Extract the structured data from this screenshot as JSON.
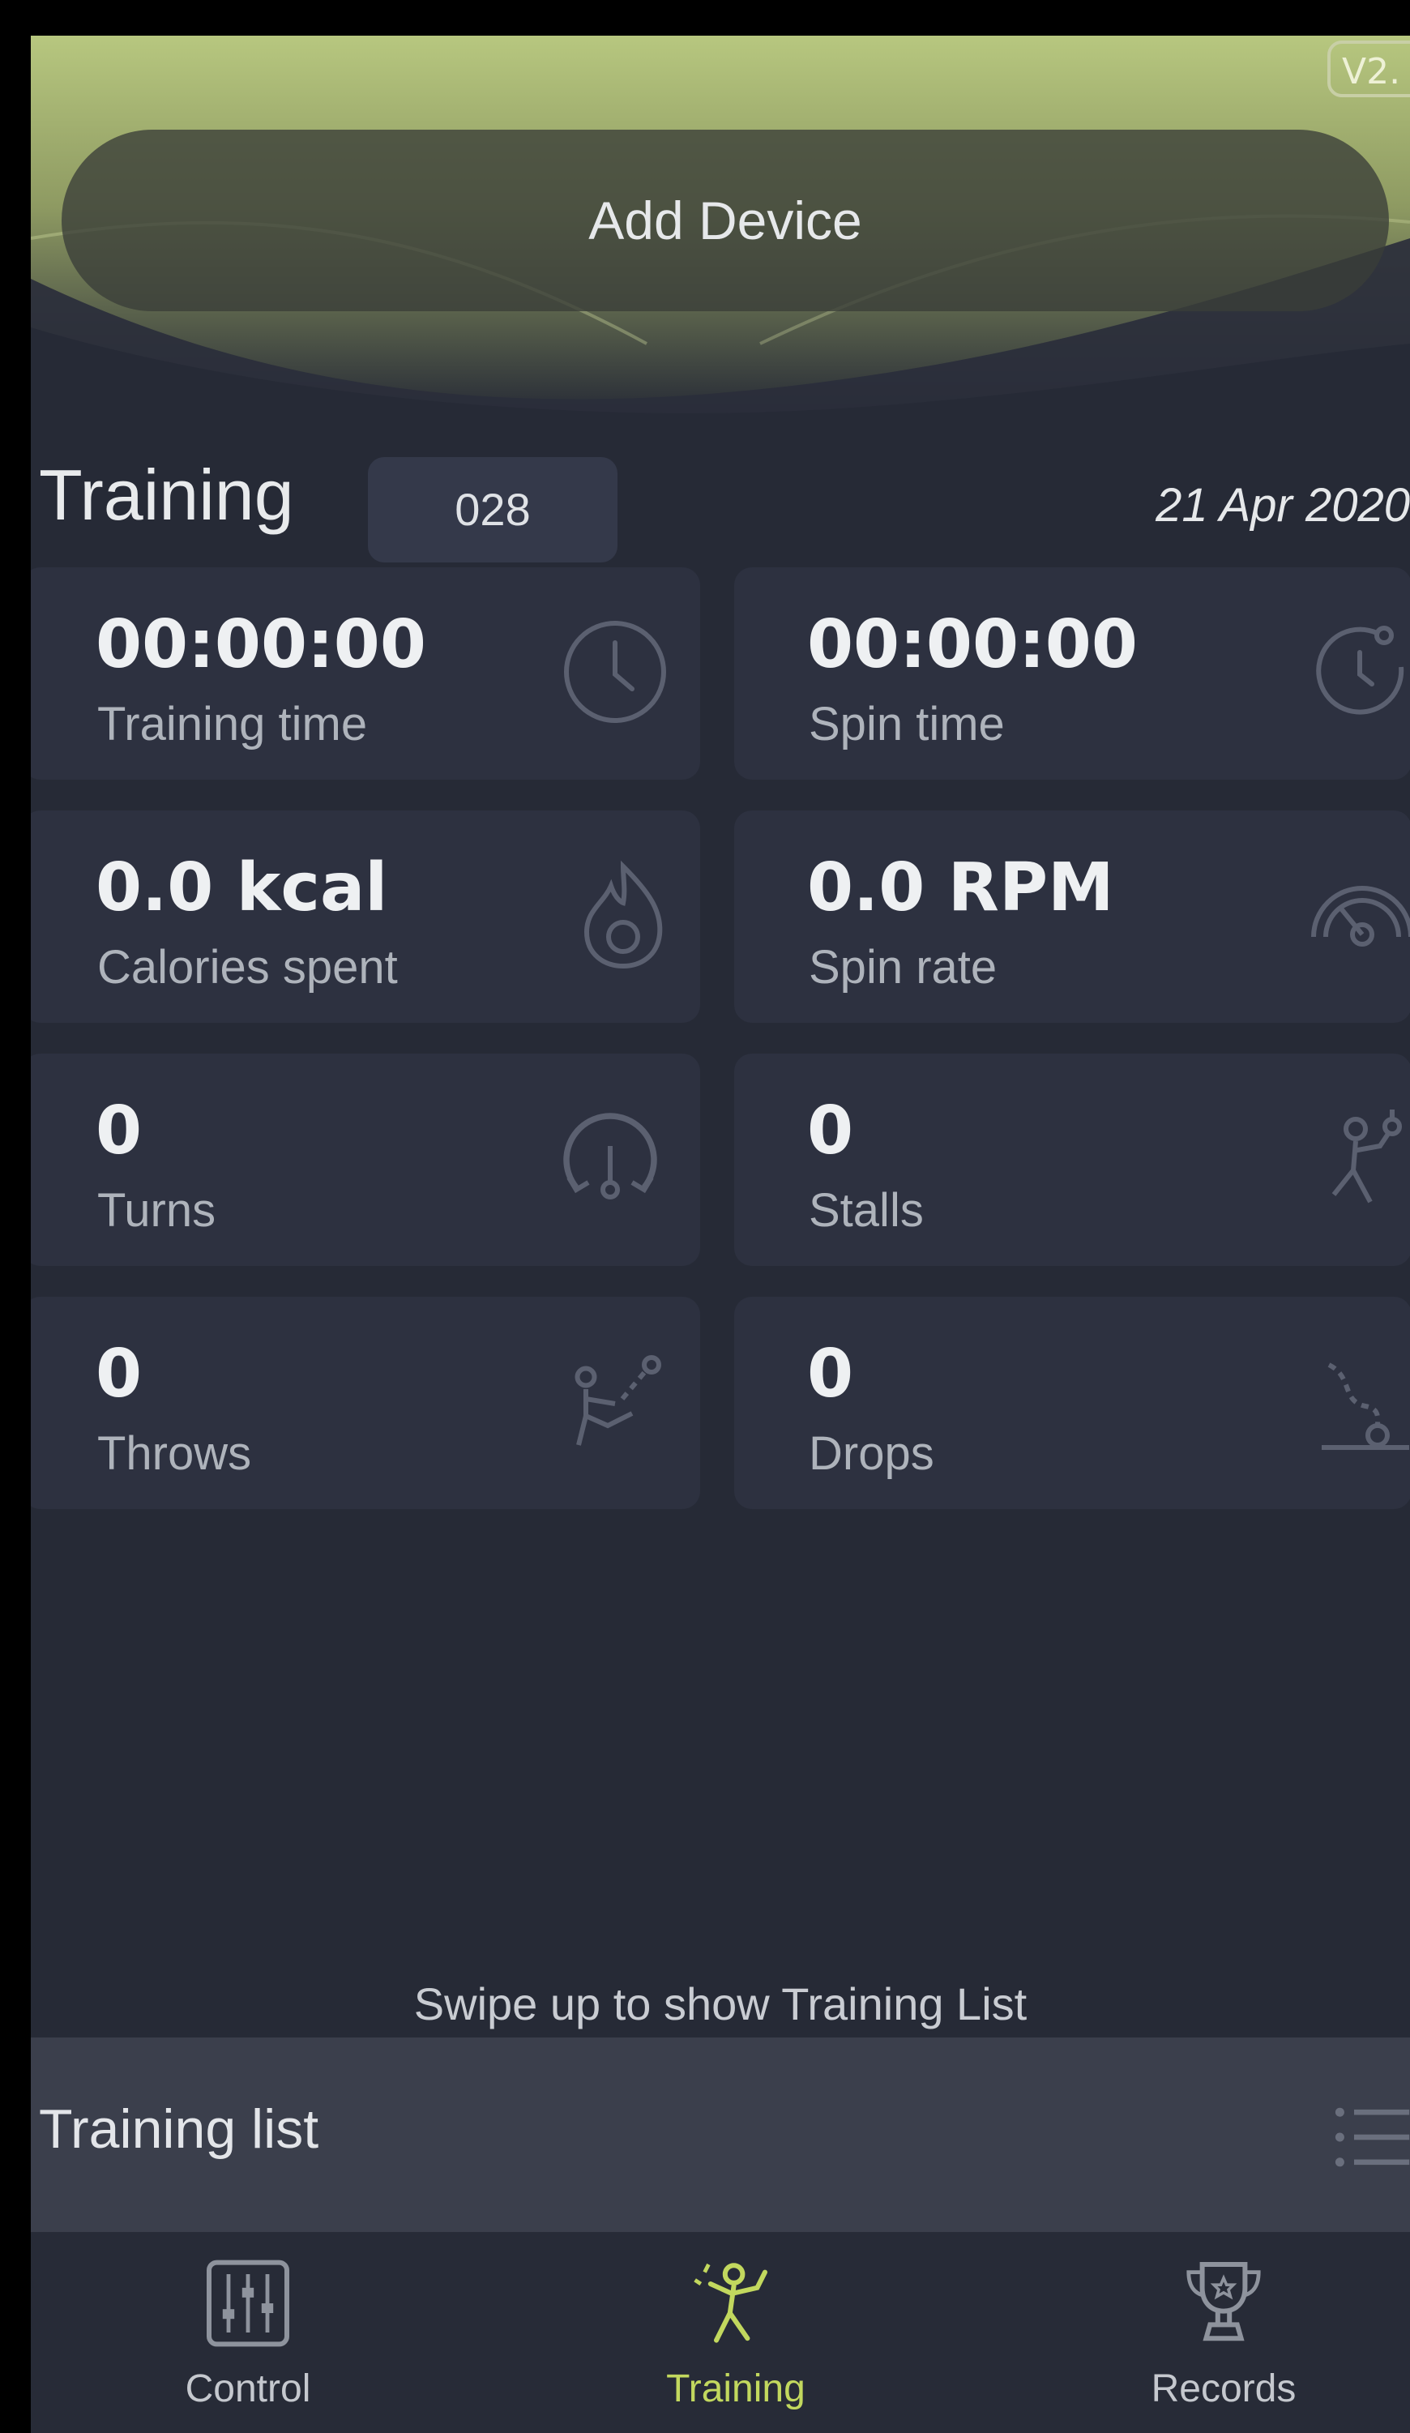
{
  "header": {
    "version": "V2.",
    "add_device_label": "Add Device"
  },
  "training": {
    "title": "Training",
    "session_number": "028",
    "date": "21 Apr 2020"
  },
  "stats": [
    {
      "value": "00:00:00",
      "label": "Training time",
      "icon": "clock-icon"
    },
    {
      "value": "00:00:00",
      "label": "Spin time",
      "icon": "spin-timer-icon"
    },
    {
      "value": "0.0 kcal",
      "label": "Calories spent",
      "icon": "flame-icon"
    },
    {
      "value": "0.0 RPM",
      "label": "Spin rate",
      "icon": "speedometer-icon"
    },
    {
      "value": "0",
      "label": "Turns",
      "icon": "turn-arrows-icon"
    },
    {
      "value": "0",
      "label": "Stalls",
      "icon": "stall-player-icon"
    },
    {
      "value": "0",
      "label": "Throws",
      "icon": "throw-player-icon"
    },
    {
      "value": "0",
      "label": "Drops",
      "icon": "drop-diabolo-icon"
    }
  ],
  "swipe_hint": "Swipe up to show Training List",
  "training_list": {
    "title": "Training list",
    "icon": "list-icon"
  },
  "nav": {
    "items": [
      {
        "label": "Control",
        "icon": "control-sliders-icon",
        "active": false
      },
      {
        "label": "Training",
        "icon": "training-figure-icon",
        "active": true
      },
      {
        "label": "Records",
        "icon": "trophy-icon",
        "active": false
      }
    ]
  },
  "colors": {
    "background": "#262a36",
    "card": "#2d3140",
    "accent": "#c2d85e",
    "header_top": "#b6c77c"
  }
}
